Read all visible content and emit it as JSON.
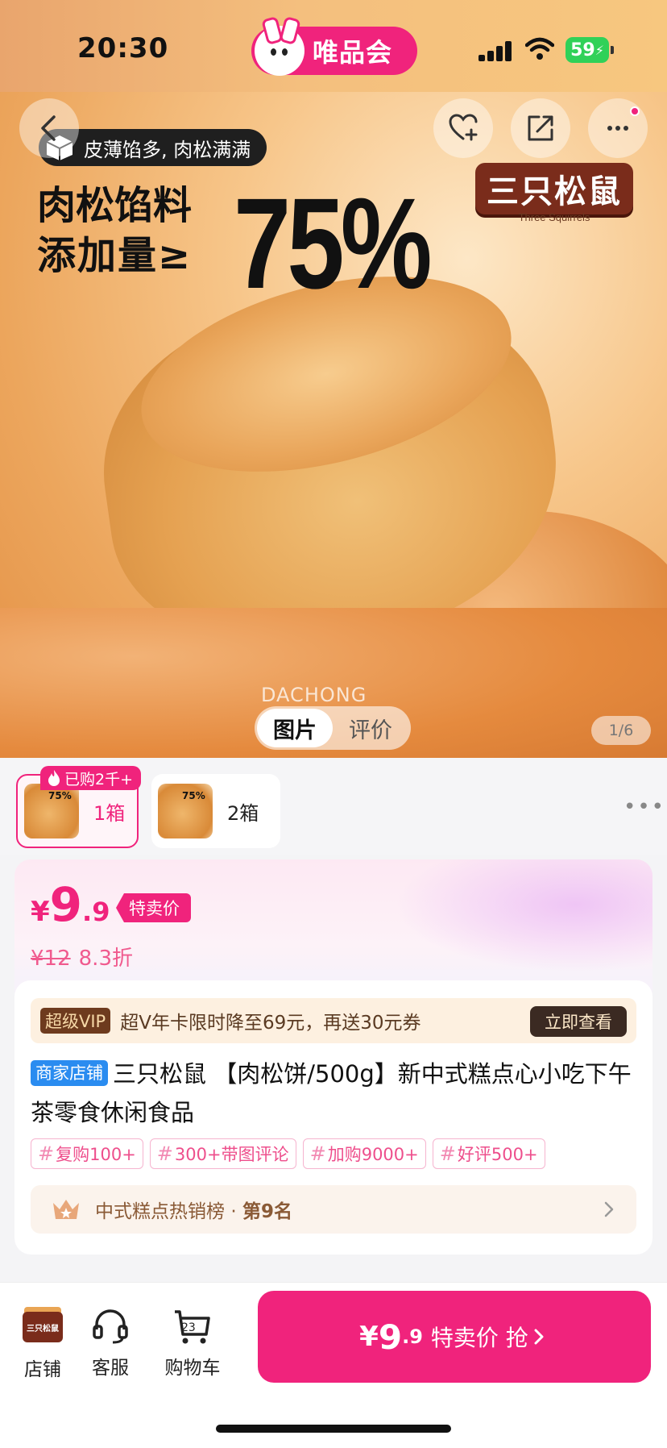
{
  "status": {
    "time": "20:30",
    "battery": "59"
  },
  "app": {
    "name": "唯品会"
  },
  "hero": {
    "tagline": "皮薄馅多, 肉松满满",
    "headline_line1": "肉松馅料",
    "headline_line2": "添加量≥",
    "headline_percent": "75%",
    "brand": "三只松鼠",
    "brand_en": "Three Squirrels",
    "watermark": "DACHONG",
    "tabs": [
      "图片",
      "评价"
    ],
    "counter": "1/6"
  },
  "variants": {
    "sold_badge": "已购2千+",
    "items": [
      {
        "label": "1箱",
        "selected": true
      },
      {
        "label": "2箱",
        "selected": false
      }
    ]
  },
  "price": {
    "currency": "¥",
    "int": "9",
    "dec": ".9",
    "tag": "特卖价",
    "original": "¥12",
    "discount": "8.3折"
  },
  "vip": {
    "tag": "超级VIP",
    "text": "超V年卡限时降至69元，再送30元券",
    "button": "立即查看"
  },
  "product": {
    "shop_tag": "商家店铺",
    "title": "三只松鼠 【肉松饼/500g】新中式糕点心小吃下午茶零食休闲食品"
  },
  "chips": [
    "复购100+",
    "300+带图评论",
    "加购9000+",
    "好评500+"
  ],
  "rank": {
    "text": "中式糕点热销榜",
    "sep": "·",
    "rank": "第9名"
  },
  "bottom": {
    "shop_label": "店铺",
    "shop_logo": "三只松鼠",
    "service_label": "客服",
    "cart_label": "购物车",
    "cart_count": "23",
    "buy_currency": "¥",
    "buy_int": "9",
    "buy_dec": ".9",
    "buy_text": "特卖价 抢"
  },
  "colors": {
    "accent": "#f0237c",
    "shop_tag": "#2a8cf0",
    "vip_bg": "#fdf0e0"
  }
}
